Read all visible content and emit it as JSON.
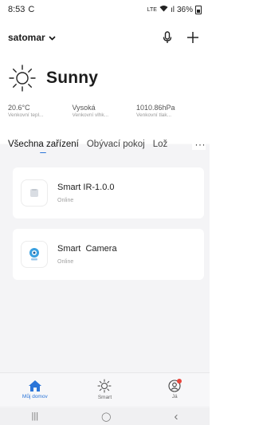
{
  "status_bar": {
    "time": "8:53",
    "sync_glyph": "C",
    "network": "LTE",
    "signal": "ıl",
    "battery": "36%"
  },
  "header": {
    "home_name": "satomar"
  },
  "weather": {
    "condition": "Sunny",
    "metrics": [
      {
        "value": "20.6°C",
        "label": "Venkovní tepl..."
      },
      {
        "value": "Vysoká",
        "label": "Venkovní vlhk..."
      },
      {
        "value": "1010.86hPa",
        "label": "Venkovní tlak..."
      }
    ]
  },
  "tabs": {
    "items": [
      "Všechna zařízení",
      "Obývací pokoj",
      "Lož"
    ],
    "active_index": 0,
    "more": "···"
  },
  "devices": [
    {
      "name": "Smart IR-1.0.0",
      "status": "Online",
      "icon": "ir-remote-icon"
    },
    {
      "name": "Smart  Camera",
      "status": "Online",
      "icon": "camera-icon"
    }
  ],
  "bottom_nav": [
    {
      "label": "Můj domov",
      "icon": "home-icon",
      "active": true
    },
    {
      "label": "Smart",
      "icon": "sun-icon",
      "active": false
    },
    {
      "label": "Já",
      "icon": "profile-icon",
      "active": false,
      "badge": true
    }
  ],
  "system_nav": {
    "recents": "|||",
    "home": "◯",
    "back": "‹"
  },
  "colors": {
    "accent": "#2b75d8",
    "badge": "#e8453c",
    "camera_accent": "#3aa0e0"
  }
}
